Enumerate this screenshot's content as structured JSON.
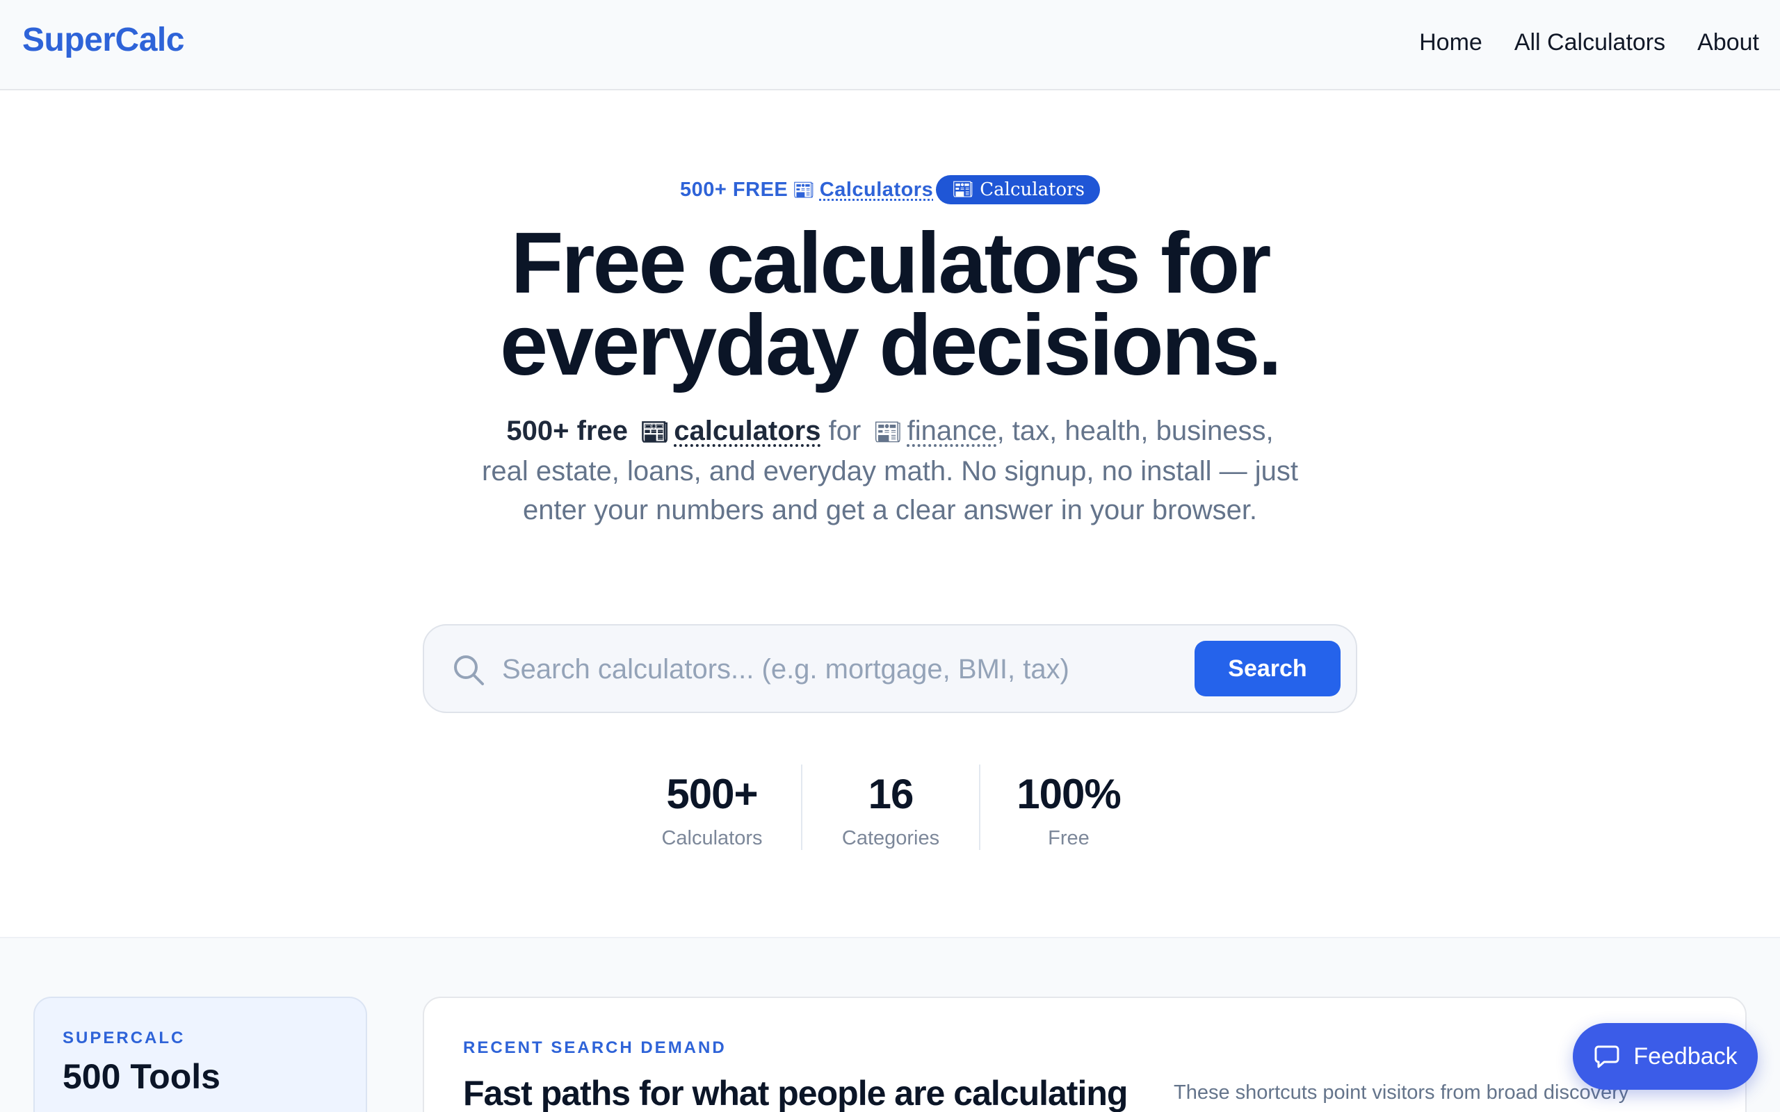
{
  "header": {
    "logo": "SuperCalc",
    "nav": [
      "Home",
      "All Calculators",
      "About"
    ]
  },
  "hero": {
    "eyebrow_prefix": "500+ FREE",
    "eyebrow_link": "Calculators",
    "eyebrow_pill": "Calculators",
    "title_line1": "Free calculators for",
    "title_line2": "everyday decisions.",
    "sub_strong": "500+ free",
    "sub_link": "calculators",
    "sub_for": "for",
    "sub_finance": "finance",
    "sub_rest_line1": ", tax, health,",
    "sub_rest": "business, real estate, loans, and everyday math. No signup, no install — just enter your numbers and get a clear answer in your browser."
  },
  "search": {
    "placeholder": "Search calculators... (e.g. mortgage, BMI, tax)",
    "button": "Search"
  },
  "stats": [
    {
      "value": "500+",
      "label": "Calculators"
    },
    {
      "value": "16",
      "label": "Categories"
    },
    {
      "value": "100%",
      "label": "Free"
    }
  ],
  "side_card": {
    "kicker": "SUPERCALC",
    "title": "500 Tools"
  },
  "main_card": {
    "kicker": "RECENT SEARCH DEMAND",
    "title": "Fast paths for what people are calculating",
    "desc": "These shortcuts point visitors from broad discovery"
  },
  "feedback": {
    "label": "Feedback"
  },
  "colors": {
    "brand": "#2e63d8",
    "button": "#2563eb",
    "feedback": "#3b5ce8",
    "heading": "#0b1527"
  },
  "icons": [
    "newspaper-icon",
    "search-icon",
    "chat-bubble-icon"
  ]
}
